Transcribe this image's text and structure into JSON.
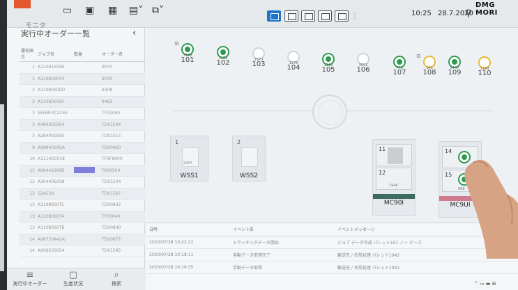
{
  "app": {
    "title": "モニタ",
    "brand": "DMG MORI",
    "time": "10:25",
    "date": "28.7.2020"
  },
  "toolbar": {
    "icons": [
      "window-icon",
      "layout-icon",
      "grid-icon",
      "copy-icon"
    ]
  },
  "left_panel": {
    "title": "実行中オーダー一覧",
    "columns": [
      "優先順位",
      "ジョブ名",
      "数量",
      "オーダー名"
    ],
    "rows": [
      {
        "no": "1",
        "job": "A11081S0SE",
        "order": "9F00"
      },
      {
        "no": "1",
        "job": "A11080SF04",
        "order": "9F00"
      },
      {
        "no": "2",
        "job": "A11080S0ED",
        "order": "9308"
      },
      {
        "no": "2",
        "job": "A11080S0SF",
        "order": "9465"
      },
      {
        "no": "3",
        "job": "SEHBF3C214E",
        "order": "TF01064"
      },
      {
        "no": "3",
        "job": "A4840S0S04",
        "order": "TD01504"
      },
      {
        "no": "3",
        "job": "A2840S0S0E",
        "order": "TD01515"
      },
      {
        "no": "9",
        "job": "A08840S0SA",
        "order": "TD00960"
      },
      {
        "no": "10",
        "job": "A11140C018",
        "order": "TF9F8000"
      },
      {
        "no": "11",
        "job": "A08442908E",
        "order": "TA00504"
      },
      {
        "no": "12",
        "job": "A20440S0S8",
        "order": "TD01504"
      },
      {
        "no": "13",
        "job": "S2A530",
        "order": "TD01507"
      },
      {
        "no": "13",
        "job": "A11080S0TC",
        "order": "TD00842"
      },
      {
        "no": "13",
        "job": "A11080S0T4",
        "order": "TF00840"
      },
      {
        "no": "13",
        "job": "A11080S0TB",
        "order": "TD00840"
      },
      {
        "no": "14",
        "job": "A08770A42A",
        "order": "TD00877"
      },
      {
        "no": "14",
        "job": "A00850S0S4",
        "order": "TD01585"
      }
    ]
  },
  "bottom_nav": [
    {
      "label": "実行中オーダー",
      "icon": "list-icon"
    },
    {
      "label": "生産状況",
      "icon": "calendar-icon"
    },
    {
      "label": "検索",
      "icon": "search-icon"
    }
  ],
  "pallets": [
    {
      "num": "101",
      "count": "7798",
      "status": "green",
      "badge": "⊙"
    },
    {
      "num": "102",
      "count": "1153",
      "status": "green",
      "badge": ""
    },
    {
      "num": "103",
      "count": "1573",
      "status": "empty",
      "badge": ""
    },
    {
      "num": "104",
      "count": "1175",
      "status": "empty",
      "badge": ""
    },
    {
      "num": "105",
      "count": "1116",
      "status": "green",
      "badge": ""
    },
    {
      "num": "106",
      "count": "3552",
      "status": "empty",
      "badge": ""
    },
    {
      "num": "107",
      "count": "771",
      "status": "green",
      "badge": ""
    },
    {
      "num": "108",
      "count": "101",
      "status": "yellow",
      "badge": "⊙"
    },
    {
      "num": "109",
      "count": "3447",
      "status": "green",
      "badge": ""
    },
    {
      "num": "110",
      "count": "1198",
      "status": "yellow",
      "badge": ""
    }
  ],
  "stations": [
    {
      "slot": "1",
      "label": "WSS1",
      "count": "2427"
    },
    {
      "slot": "2",
      "label": "WSS2",
      "count": ""
    }
  ],
  "machines": [
    {
      "label": "MC90I",
      "bays": [
        {
          "n": "11",
          "count": ""
        },
        {
          "n": "12",
          "count": "1946"
        }
      ],
      "strip": "green"
    },
    {
      "label": "MC9UI",
      "bays": [
        {
          "n": "14",
          "count": ""
        },
        {
          "n": "15",
          "count": "688"
        }
      ],
      "strip": "red"
    }
  ],
  "events": {
    "columns": [
      "日時",
      "イベント名",
      "イベントメッセージ"
    ],
    "rows": [
      {
        "time": "2020/07/28 10:22:22",
        "name": "トラッキングデータ開始",
        "msg": "ジョブ データ作成 パレット101 ノー ピーエ"
      },
      {
        "time": "2020/07/28 10:18:11",
        "name": "手動データ取得完了",
        "msg": "輸送先 / 名前処理 パレット1042"
      },
      {
        "time": "2020/07/28 10:16:35",
        "name": "手動データ取得",
        "msg": "輸送先 / 名前処理 パレット1042"
      }
    ]
  }
}
